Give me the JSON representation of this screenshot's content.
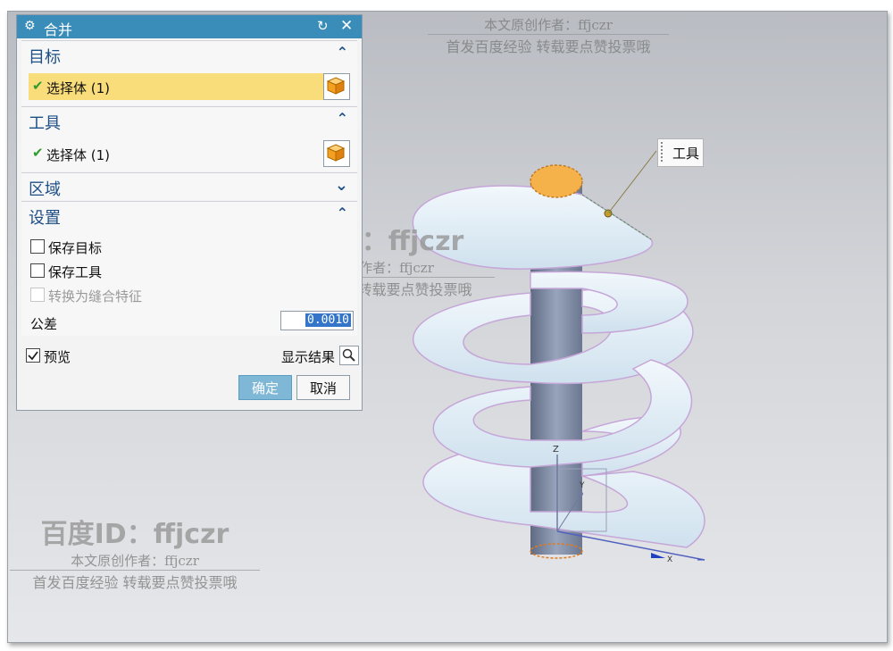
{
  "dialog": {
    "title": "合并",
    "target": {
      "title": "目标",
      "selection": "选择体 (1)"
    },
    "tool": {
      "title": "工具",
      "selection": "选择体 (1)"
    },
    "region": {
      "title": "区域"
    },
    "settings": {
      "title": "设置",
      "keep_target": "保存目标",
      "keep_tool": "保存工具",
      "convert_seam": "转换为缝合特征",
      "tolerance_label": "公差",
      "tolerance_value": "0.0010"
    },
    "preview_label": "预览",
    "show_result_label": "显示结果",
    "ok_label": "确定",
    "cancel_label": "取消"
  },
  "viewport": {
    "tool_label": "工具",
    "axis_z": "Z",
    "axis_y": "Y",
    "axis_x": "X"
  },
  "watermark": {
    "id_line": "百度ID：ffjczr",
    "author_line": "本文原创作者：ffjczr",
    "notice_line": "首发百度经验 转载要点赞投票哦"
  },
  "colors": {
    "titlebar": "#3a8db8",
    "highlight": "#f9dd7a",
    "accent": "#3275c9"
  }
}
